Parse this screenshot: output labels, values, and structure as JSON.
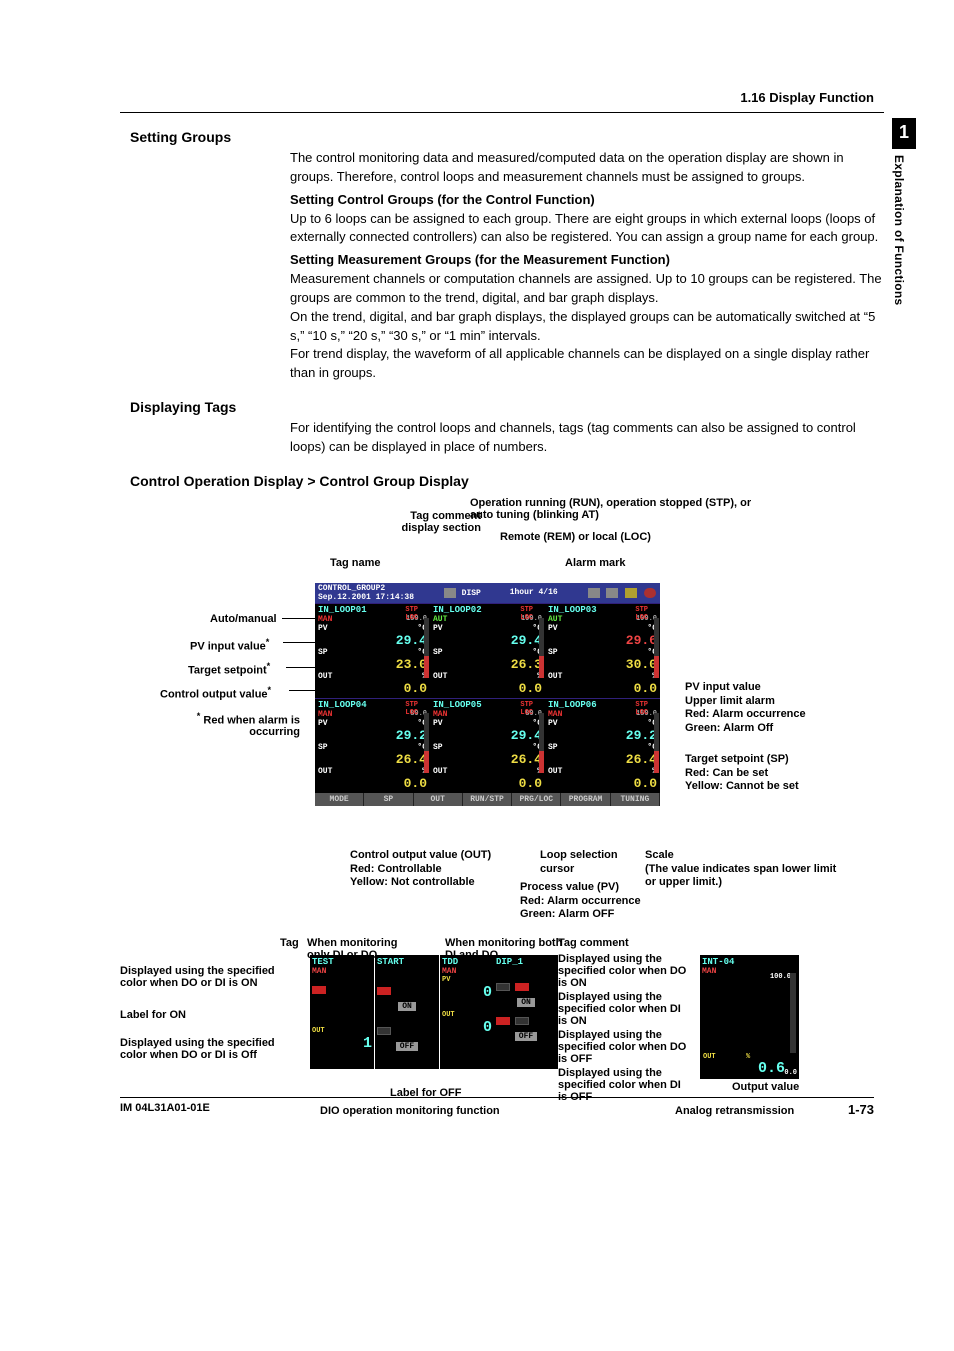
{
  "header": {
    "section": "1.16  Display Function"
  },
  "tab": {
    "num": "1",
    "label": "Explanation of Functions"
  },
  "sec1": {
    "title": "Setting Groups",
    "p1": "The control monitoring data and measured/computed data on the operation display are shown in groups.  Therefore, control loops and measurement channels must be assigned to groups.",
    "h1": "Setting Control Groups (for the Control Function)",
    "p2": "Up to 6 loops can be assigned to each group.  There are eight groups in which external loops (loops of externally connected controllers) can also be registered.  You can assign a group name for each group.",
    "h2": "Setting Measurement Groups (for the Measurement Function)",
    "p3": "Measurement channels or computation channels are assigned.  Up to 10 groups can be registered.  The groups are common to the trend, digital, and bar graph displays.",
    "p4": "On the trend, digital, and bar graph displays, the displayed groups can be automatically switched at “5 s,” “10 s,” “20 s,” “30 s,” or “1 min” intervals.",
    "p5": "For trend display, the waveform of all applicable channels can be displayed on a single display rather than in groups."
  },
  "sec2": {
    "title": "Displaying Tags",
    "p1": "For identifying the control loops and channels, tags (tag comments can also be assigned to control loops) can be displayed in place of numbers."
  },
  "sec3": {
    "title": "Control Operation Display > Control Group Display"
  },
  "fig": {
    "top": {
      "op": "Operation running (RUN), operation stopped (STP), or auto tuning (blinking AT)",
      "tagc": "Tag comment display section",
      "rem": "Remote (REM) or local (LOC)",
      "tagn": "Tag name",
      "alm": "Alarm mark"
    },
    "left": {
      "auto": "Auto/manual",
      "pv": "PV input value",
      "sp": "Target setpoint",
      "out": "Control output value",
      "red": "Red when alarm is occurring",
      "ast": "*"
    },
    "right": {
      "pv": "PV input value",
      "ul": "Upper limit alarm",
      "r1": "Red:     Alarm occurrence",
      "g1": "Green:  Alarm Off",
      "sp": "Target setpoint (SP)",
      "r2": "Red:     Can be set",
      "y2": "Yellow: Cannot be set",
      "sc": "Scale",
      "scd": "(The value indicates span lower limit or upper limit.)"
    },
    "bot": {
      "out": "Control output value (OUT)",
      "out_r": "Red:     Controllable",
      "out_y": "Yellow: Not controllable",
      "loop": "Loop selection cursor",
      "pv": "Process value (PV)",
      "pv_r": "Red:     Alarm occurrence",
      "pv_g": "Green:  Alarm OFF"
    },
    "scr": {
      "title": "CONTROL_GROUP2",
      "date": "Sep.12.2001 17:14:38",
      "disp": "DISP",
      "hour": "1hour 4/16",
      "loops": [
        {
          "n": "IN_LOOP01",
          "m": "MAN",
          "mr": true,
          "pv": "29.4",
          "sp": "23.0",
          "out": "0.0",
          "max": "150.0"
        },
        {
          "n": "IN_LOOP02",
          "m": "AUT",
          "mr": false,
          "pv": "29.4",
          "sp": "26.3",
          "out": "0.0",
          "max": "100.0"
        },
        {
          "n": "IN_LOOP03",
          "m": "AUT",
          "mr": false,
          "pv": "29.6",
          "pvr": true,
          "sp": "30.0",
          "out": "0.0",
          "max": "100.0"
        },
        {
          "n": "IN_LOOP04",
          "m": "MAN",
          "mr": true,
          "pv": "29.2",
          "sp": "26.4",
          "out": "0.0",
          "max": "80.0"
        },
        {
          "n": "IN_LOOP05",
          "m": "MAN",
          "mr": true,
          "pv": "29.4",
          "sp": "26.4",
          "out": "0.0",
          "max": "80.0"
        },
        {
          "n": "IN_LOOP06",
          "m": "MAN",
          "mr": true,
          "pv": "29.2",
          "sp": "26.4",
          "out": "0.0",
          "max": "150.0"
        }
      ],
      "ft": [
        "MODE",
        "SP",
        "OUT",
        "RUN/STP",
        "PRG/LOC",
        "PROGRAM",
        "TUNING"
      ],
      "stp": "STP",
      "loc": "LOC",
      "unit": "°C",
      "pvl": "PV",
      "spl": "SP",
      "outl": "OUT",
      "pct": "%"
    },
    "dio": {
      "tagh": "Tag",
      "h1": "When monitoring only DI or DO",
      "h2": "When monitoring both DI and DO",
      "tc": "Tag comment",
      "l1a": "Displayed using the specified color when DO or DI is ON",
      "l1b": "Label for ON",
      "l2a": "Displayed using the specified color when DO or DI is Off",
      "r1": "Displayed using the specified color when DO is ON",
      "r2": "Displayed using the specified color when DI is ON",
      "r3": "Displayed using the specified color when DO is OFF",
      "r4": "Displayed using the specified color when DI is OFF",
      "loff": "Label for OFF",
      "cap": "DIO operation monitoring function",
      "ar": "Analog retransmission",
      "ov": "Output value",
      "p1": {
        "t": "TEST",
        "m": "MAN",
        "on": "ON",
        "off": "1",
        "out": "OUT"
      },
      "p2": {
        "t": "START",
        "on": "ON",
        "off": "OFF"
      },
      "p3": {
        "t": "TDD",
        "m": "MAN",
        "pv": "PV",
        "on": "0",
        "off": "OFF",
        "out": "OUT"
      },
      "p4": {
        "t": "DIP_1",
        "on": "ON",
        "off": "OFF",
        "v0": "0"
      },
      "p5": {
        "t": "INT-04",
        "m": "MAN",
        "out": "OUT",
        "pct": "%",
        "v": "0.6",
        "max": "100.0",
        "min": "0.0"
      }
    }
  },
  "footer": {
    "l": "IM 04L31A01-01E",
    "r": "1-73"
  }
}
